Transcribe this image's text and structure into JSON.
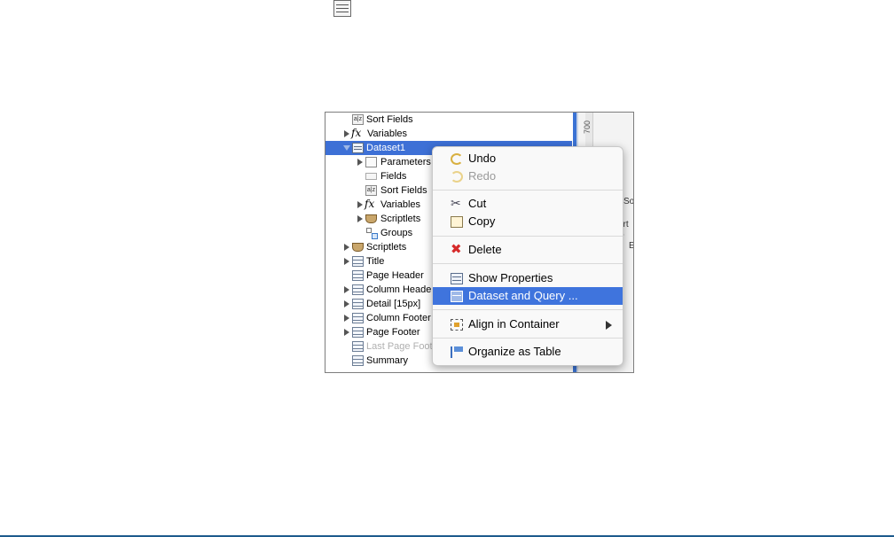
{
  "tree": {
    "rows": [
      {
        "label": "Sort Fields",
        "icon": "sort-az-icon"
      },
      {
        "label": "Variables",
        "icon": "fx-icon"
      },
      {
        "label": "Dataset1",
        "icon": "dataset-icon"
      },
      {
        "label": "Parameters",
        "icon": "parameters-icon"
      },
      {
        "label": "Fields",
        "icon": "fields-icon"
      },
      {
        "label": "Sort Fields",
        "icon": "sort-az-icon"
      },
      {
        "label": "Variables",
        "icon": "fx-icon"
      },
      {
        "label": "Scriptlets",
        "icon": "scriptlet-icon"
      },
      {
        "label": "Groups",
        "icon": "groups-icon"
      },
      {
        "label": "Scriptlets",
        "icon": "scriptlet-icon"
      },
      {
        "label": "Title",
        "icon": "band-icon"
      },
      {
        "label": "Page Header",
        "icon": "band-icon"
      },
      {
        "label": "Column Heade",
        "icon": "band-icon"
      },
      {
        "label": "Detail [15px]",
        "icon": "band-icon"
      },
      {
        "label": "Column Footer",
        "icon": "band-icon"
      },
      {
        "label": "Page Footer",
        "icon": "band-icon"
      },
      {
        "label": "Last Page Foot",
        "icon": "band-icon"
      },
      {
        "label": "Summary",
        "icon": "band-icon"
      }
    ]
  },
  "ruler": {
    "mark": "700"
  },
  "peek": {
    "a": "Sor",
    "b": "ort S",
    "c": "E"
  },
  "context_menu": {
    "items": [
      {
        "label": "Undo",
        "icon": "undo-icon",
        "enabled": true
      },
      {
        "label": "Redo",
        "icon": "redo-icon",
        "enabled": false
      },
      {
        "label": "Cut",
        "icon": "scissors-icon",
        "enabled": true
      },
      {
        "label": "Copy",
        "icon": "copy-icon",
        "enabled": true
      },
      {
        "label": "Delete",
        "icon": "delete-icon",
        "enabled": true
      },
      {
        "label": "Show Properties",
        "icon": "properties-icon",
        "enabled": true
      },
      {
        "label": "Dataset and Query ...",
        "icon": "dataset-query-icon",
        "enabled": true,
        "highlighted": true
      },
      {
        "label": "Align in Container",
        "icon": "align-icon",
        "enabled": true,
        "submenu": true
      },
      {
        "label": "Organize as Table",
        "icon": "table-icon",
        "enabled": true
      }
    ]
  },
  "colors": {
    "selection": "#3d70d6",
    "menu_highlight": "#3f74dd",
    "delete_icon": "#d62a2a"
  }
}
